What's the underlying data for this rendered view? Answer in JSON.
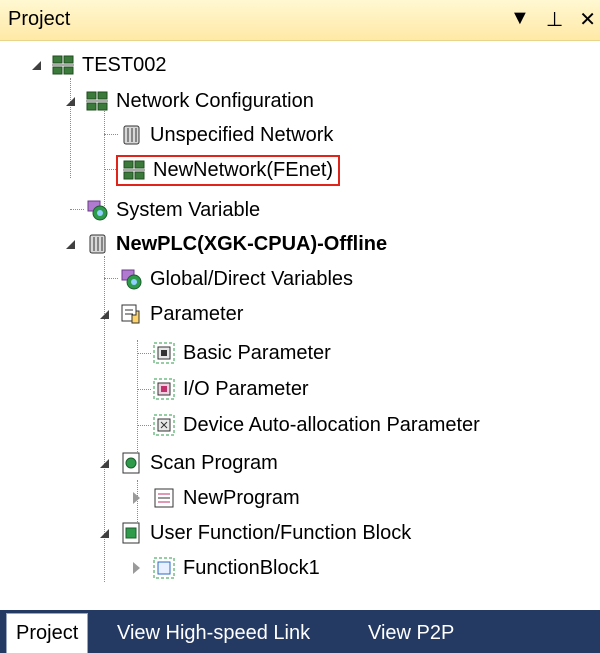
{
  "panel": {
    "title": "Project",
    "menu_icon": "▼",
    "pin_icon": "⊥",
    "close_icon": "✕"
  },
  "tree": {
    "root": "TEST002",
    "network_configuration": "Network Configuration",
    "unspecified_network": "Unspecified Network",
    "new_network": "NewNetwork(FEnet)",
    "system_variable": "System Variable",
    "plc": "NewPLC(XGK-CPUA)-Offline",
    "global_direct_variables": "Global/Direct Variables",
    "parameter": "Parameter",
    "basic_parameter": "Basic Parameter",
    "io_parameter": "I/O Parameter",
    "device_auto_allocation_parameter": "Device Auto-allocation Parameter",
    "scan_program": "Scan Program",
    "new_program": "NewProgram",
    "user_function_block": "User Function/Function Block",
    "function_block1": "FunctionBlock1"
  },
  "tabs": [
    "Project",
    "View High-speed Link",
    "View P2P"
  ]
}
